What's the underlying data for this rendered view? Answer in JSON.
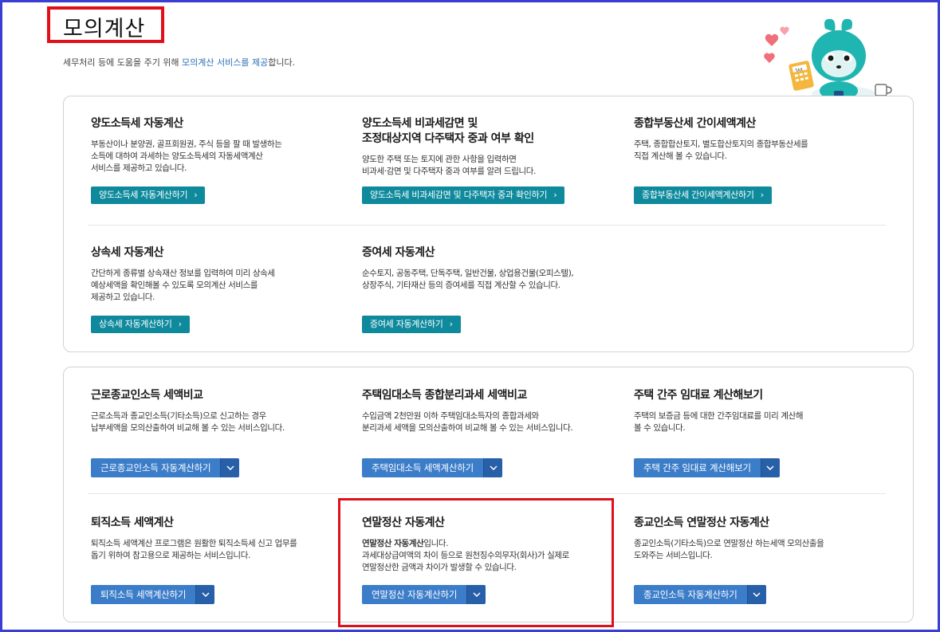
{
  "page": {
    "title": "모의계산",
    "subtitle_prefix": "세무처리 등에 도움을 주기 위해 ",
    "subtitle_link": "모의계산 서비스를 제공",
    "subtitle_suffix": "합니다."
  },
  "colors": {
    "frame": "#3b3fd1",
    "highlight": "#e0101a",
    "teal_button": "#0f8a9d",
    "blue_button": "#3c7dc9",
    "blue_button_dropdown": "#2760a8"
  },
  "panel1": {
    "cards": [
      {
        "title_lines": [
          "양도소득세 자동계산"
        ],
        "desc_lines": [
          "부동산이나 분양권, 골프회원권, 주식 등을 팔 때 발생하는",
          "소득에 대하여 과세하는 양도소득세의 자동세액계산",
          "서비스를 제공하고 있습니다."
        ],
        "button": "양도소득세 자동계산하기"
      },
      {
        "title_lines": [
          "양도소득세 비과세감면 및",
          "조정대상지역 다주택자 중과 여부 확인"
        ],
        "desc_lines": [
          "양도한 주택 또는 토지에 관한 사항을 입력하면",
          "비과세·감면 및 다주택자 중과 여부를 알려 드립니다."
        ],
        "button": "양도소득세 비과세감면 및 다주택자 중과 확인하기"
      },
      {
        "title_lines": [
          "종합부동산세 간이세액계산"
        ],
        "desc_lines": [
          "주택, 종합합산토지, 별도합산토지의 종합부동산세를",
          "직접 계산해 볼 수 있습니다."
        ],
        "button": "종합부동산세 간이세액계산하기"
      },
      {
        "title_lines": [
          "상속세 자동계산"
        ],
        "desc_lines": [
          "간단하게 종류별 상속재산 정보를 입력하여 미리 상속세",
          "예상세액을 확인해볼 수 있도록 모의계산 서비스를",
          "제공하고 있습니다."
        ],
        "button": "상속세 자동계산하기"
      },
      {
        "title_lines": [
          "증여세 자동계산"
        ],
        "desc_lines": [
          "순수토지, 공동주택, 단독주택, 일반건물, 상업용건물(오피스텔),",
          "상장주식, 기타재산 등의 증여세를 직접 계산할 수 있습니다."
        ],
        "button": "증여세 자동계산하기"
      }
    ]
  },
  "panel2": {
    "cards": [
      {
        "title_lines": [
          "근로종교인소득 세액비교"
        ],
        "desc_lines": [
          "근로소득과 종교인소득(기타소득)으로 신고하는 경우",
          "납부세액을 모의산출하여 비교해 볼 수 있는 서비스입니다."
        ],
        "button": "근로종교인소득 자동계산하기"
      },
      {
        "title_lines": [
          "주택임대소득 종합분리과세 세액비교"
        ],
        "desc_lines": [
          "수입금액 2천만원 이하 주택임대소득자의 종합과세와",
          "분리과세 세액을 모의산출하여 비교해 볼 수 있는 서비스입니다."
        ],
        "button": "주택임대소득 세액계산하기"
      },
      {
        "title_lines": [
          "주택 간주 임대료 계산해보기"
        ],
        "desc_lines": [
          "주택의 보증금 등에 대한 간주임대료를 미리 계산해",
          "볼 수 있습니다."
        ],
        "button": "주택 간주 임대료 계산해보기"
      },
      {
        "title_lines": [
          "퇴직소득 세액계산"
        ],
        "desc_lines": [
          "퇴직소득 세액계산 프로그램은 원활한 퇴직소득세 신고 업무를",
          "돕기 위하여 참고용으로 제공하는 서비스입니다."
        ],
        "button": "퇴직소득 세액계산하기"
      },
      {
        "title_lines": [
          "연말정산 자동계산"
        ],
        "desc_bold": "연말정산 자동계산",
        "desc_bold_suffix": "입니다.",
        "desc_lines": [
          "과세대상급여액의 차이 등으로 원천징수의무자(회사)가 실제로",
          "연말정산한 금액과 차이가 발생할 수 있습니다."
        ],
        "button": "연말정산 자동계산하기"
      },
      {
        "title_lines": [
          "종교인소득 연말정산 자동계산"
        ],
        "desc_lines": [
          "종교인소득(기타소득)으로 연말정산 하는세액 모의산출을",
          "도와주는 서비스입니다."
        ],
        "button": "종교인소득 자동계산하기"
      }
    ]
  },
  "mascot": {
    "calculator_label": "TAX"
  },
  "icons": {
    "chevron_right": "›",
    "chevron_down": "chevron-down-icon"
  }
}
